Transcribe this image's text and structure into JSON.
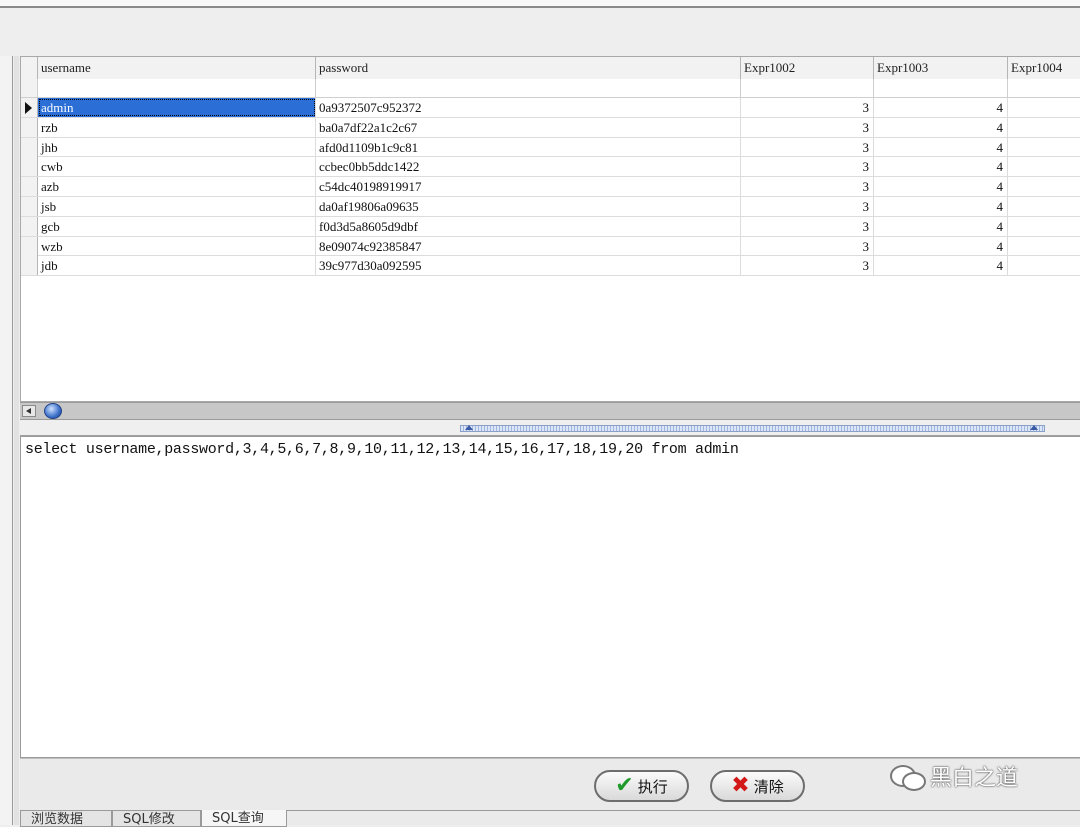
{
  "grid": {
    "columns": [
      "username",
      "password",
      "Expr1002",
      "Expr1003",
      "Expr1004"
    ],
    "rows": [
      {
        "username": "admin",
        "password": "0a9372507c952372",
        "expr1002": "3",
        "expr1003": "4"
      },
      {
        "username": "rzb",
        "password": "ba0a7df22a1c2c67",
        "expr1002": "3",
        "expr1003": "4"
      },
      {
        "username": "jhb",
        "password": "afd0d1109b1c9c81",
        "expr1002": "3",
        "expr1003": "4"
      },
      {
        "username": "cwb",
        "password": "ccbec0bb5ddc1422",
        "expr1002": "3",
        "expr1003": "4"
      },
      {
        "username": "azb",
        "password": "c54dc40198919917",
        "expr1002": "3",
        "expr1003": "4"
      },
      {
        "username": "jsb",
        "password": "da0af19806a09635",
        "expr1002": "3",
        "expr1003": "4"
      },
      {
        "username": "gcb",
        "password": "f0d3d5a8605d9dbf",
        "expr1002": "3",
        "expr1003": "4"
      },
      {
        "username": "wzb",
        "password": "8e09074c92385847",
        "expr1002": "3",
        "expr1003": "4"
      },
      {
        "username": "jdb",
        "password": "39c977d30a092595",
        "expr1002": "3",
        "expr1003": "4"
      }
    ],
    "selected_row": 0
  },
  "editor": {
    "sql": "select username,password,3,4,5,6,7,8,9,10,11,12,13,14,15,16,17,18,19,20 from admin"
  },
  "buttons": {
    "execute_label": "执行",
    "clear_label": "清除"
  },
  "watermark": {
    "text": "黑白之道"
  },
  "tabs": [
    "浏览数据",
    "SQL修改",
    "SQL查询"
  ],
  "active_tab": 2,
  "colors": {
    "selection": "#2b6fd6",
    "check": "#1f9a2a",
    "clear_x": "#d31818"
  }
}
